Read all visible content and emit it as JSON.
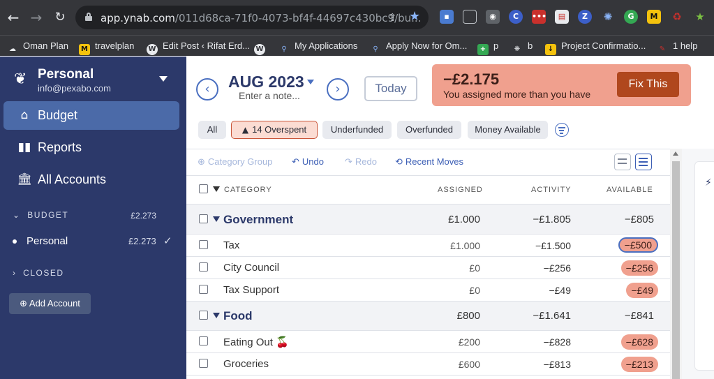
{
  "browser": {
    "url_host": "app.ynab.com",
    "url_path": "/011d68ca-71f0-4073-bf4f-44697c430bc9/bu...",
    "bookmarks": [
      "Oman Plan",
      "travelplan",
      "Edit Post ‹ Rifat Erd...",
      "My Applications",
      "Apply Now for Om...",
      "p",
      "b",
      "Project Confirmatio...",
      "1 help"
    ]
  },
  "sidebar": {
    "budget_name": "Personal",
    "budget_email": "info@pexabo.com",
    "nav": [
      {
        "label": "Budget",
        "icon": "budget-icon"
      },
      {
        "label": "Reports",
        "icon": "reports-icon"
      },
      {
        "label": "All Accounts",
        "icon": "bank-icon"
      }
    ],
    "budget_section_label": "BUDGET",
    "budget_section_amount": "£2.273",
    "account_name": "Personal",
    "account_amount": "£2.273",
    "closed_label": "CLOSED",
    "add_account_label": "Add Account"
  },
  "header": {
    "month": "AUG 2023",
    "note_placeholder": "Enter a note...",
    "today_label": "Today",
    "alert_amount": "−£2.175",
    "alert_message": "You assigned more than you have",
    "fix_label": "Fix This"
  },
  "filters": {
    "all": "All",
    "overspent": "14 Overspent",
    "underfunded": "Underfunded",
    "overfunded": "Overfunded",
    "money_available": "Money Available"
  },
  "toolbar": {
    "category_group": "Category Group",
    "undo": "Undo",
    "redo": "Redo",
    "recent_moves": "Recent Moves"
  },
  "columns": {
    "category": "CATEGORY",
    "assigned": "ASSIGNED",
    "activity": "ACTIVITY",
    "available": "AVAILABLE"
  },
  "rows": [
    {
      "type": "group",
      "name": "Government",
      "assigned": "£1.000",
      "activity": "−£1.805",
      "available": "−£805"
    },
    {
      "type": "item",
      "name": "Tax",
      "assigned": "£1.000",
      "activity": "−£1.500",
      "available": "−£500"
    },
    {
      "type": "item",
      "name": "City Council",
      "assigned": "£0",
      "activity": "−£256",
      "available": "−£256"
    },
    {
      "type": "item",
      "name": "Tax Support",
      "assigned": "£0",
      "activity": "−£49",
      "available": "−£49"
    },
    {
      "type": "group",
      "name": "Food",
      "assigned": "£800",
      "activity": "−£1.641",
      "available": "−£841"
    },
    {
      "type": "item",
      "name": "Eating Out 🍒",
      "assigned": "£200",
      "activity": "−£828",
      "available": "−£628"
    },
    {
      "type": "item",
      "name": "Groceries",
      "assigned": "£600",
      "activity": "−£813",
      "available": "−£213"
    }
  ],
  "colors": {
    "sidebar": "#2c396a",
    "sidebar_active": "#4b6aa8",
    "overspent_pill": "#f0a08e",
    "fix_button": "#b0471d",
    "accent": "#4a6fc0"
  }
}
